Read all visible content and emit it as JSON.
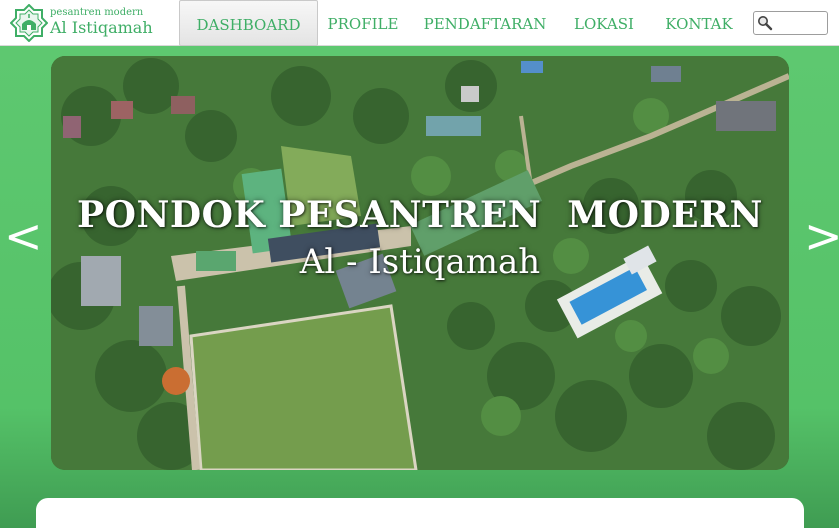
{
  "brand": {
    "tagline": "pesantren modern",
    "name": "Al Istiqamah"
  },
  "nav": {
    "items": [
      {
        "label": "DASHBOARD",
        "active": true
      },
      {
        "label": "PROFILE"
      },
      {
        "label": "PENDAFTARAN"
      },
      {
        "label": "LOKASI"
      },
      {
        "label": "KONTAK"
      }
    ]
  },
  "search": {
    "value": "",
    "placeholder": ""
  },
  "slider": {
    "title": "PONDOK PESANTREN  MODERN",
    "subtitle": "Al - Istiqamah",
    "prev_label": "<",
    "next_label": ">"
  },
  "colors": {
    "accent": "#3fae66",
    "slider_bg": "#5ec870"
  }
}
